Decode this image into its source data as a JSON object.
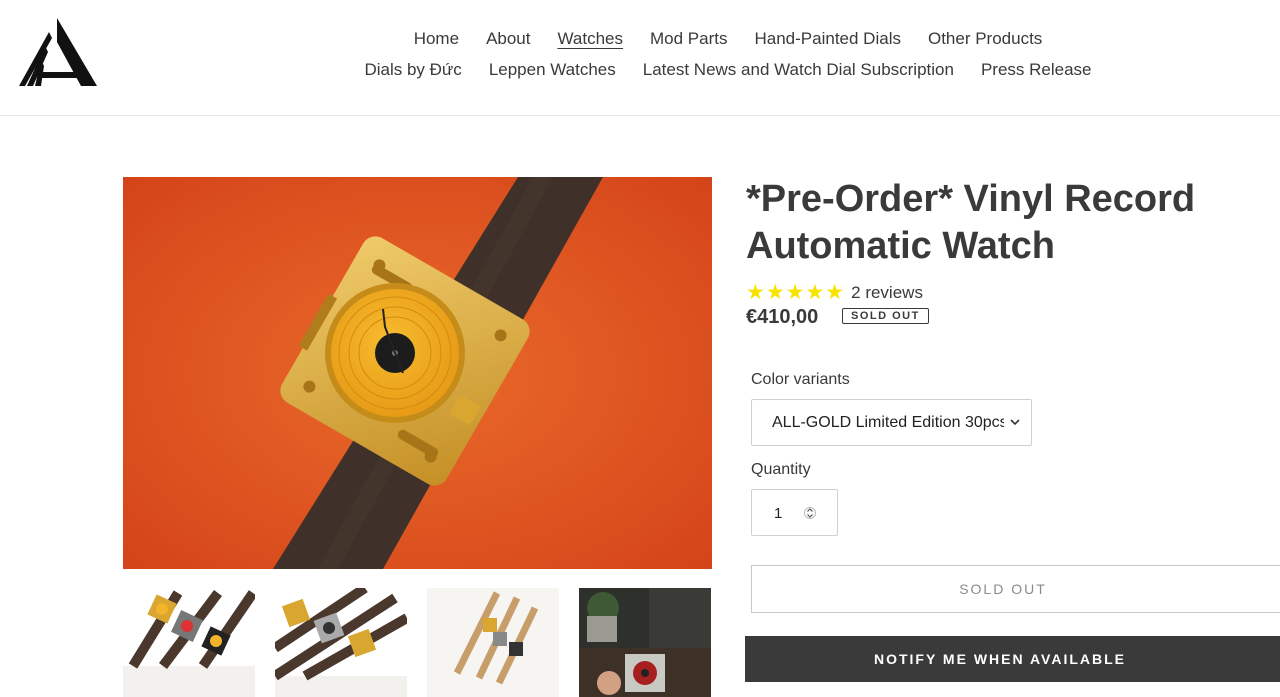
{
  "nav": {
    "row1": [
      "Home",
      "About",
      "Watches",
      "Mod Parts",
      "Hand-Painted Dials",
      "Other Products"
    ],
    "row2": [
      "Dials by Đức",
      "Leppen Watches",
      "Latest News and Watch Dial Subscription",
      "Press Release"
    ],
    "active": "Watches"
  },
  "logo": {
    "icon": "brand-a-logo-icon"
  },
  "product": {
    "title": "*Pre-Order* Vinyl Record Automatic Watch",
    "stars": "★★★★★",
    "rating": 5,
    "reviews": "2 reviews",
    "price": "€410,00",
    "badge": "SOLD OUT"
  },
  "options": {
    "color_label": "Color variants",
    "color_value": "ALL-GOLD Limited Edition 30pcs",
    "quantity_label": "Quantity",
    "quantity_value": "1"
  },
  "buttons": {
    "sold_out": "SOLD OUT",
    "notify": "NOTIFY ME WHEN AVAILABLE"
  },
  "colors": {
    "accent_dark": "#3a3a3a",
    "star": "#f7e300",
    "background_orange": "#e0521f",
    "strap": "#3f3129",
    "gold": "#d9a730"
  }
}
